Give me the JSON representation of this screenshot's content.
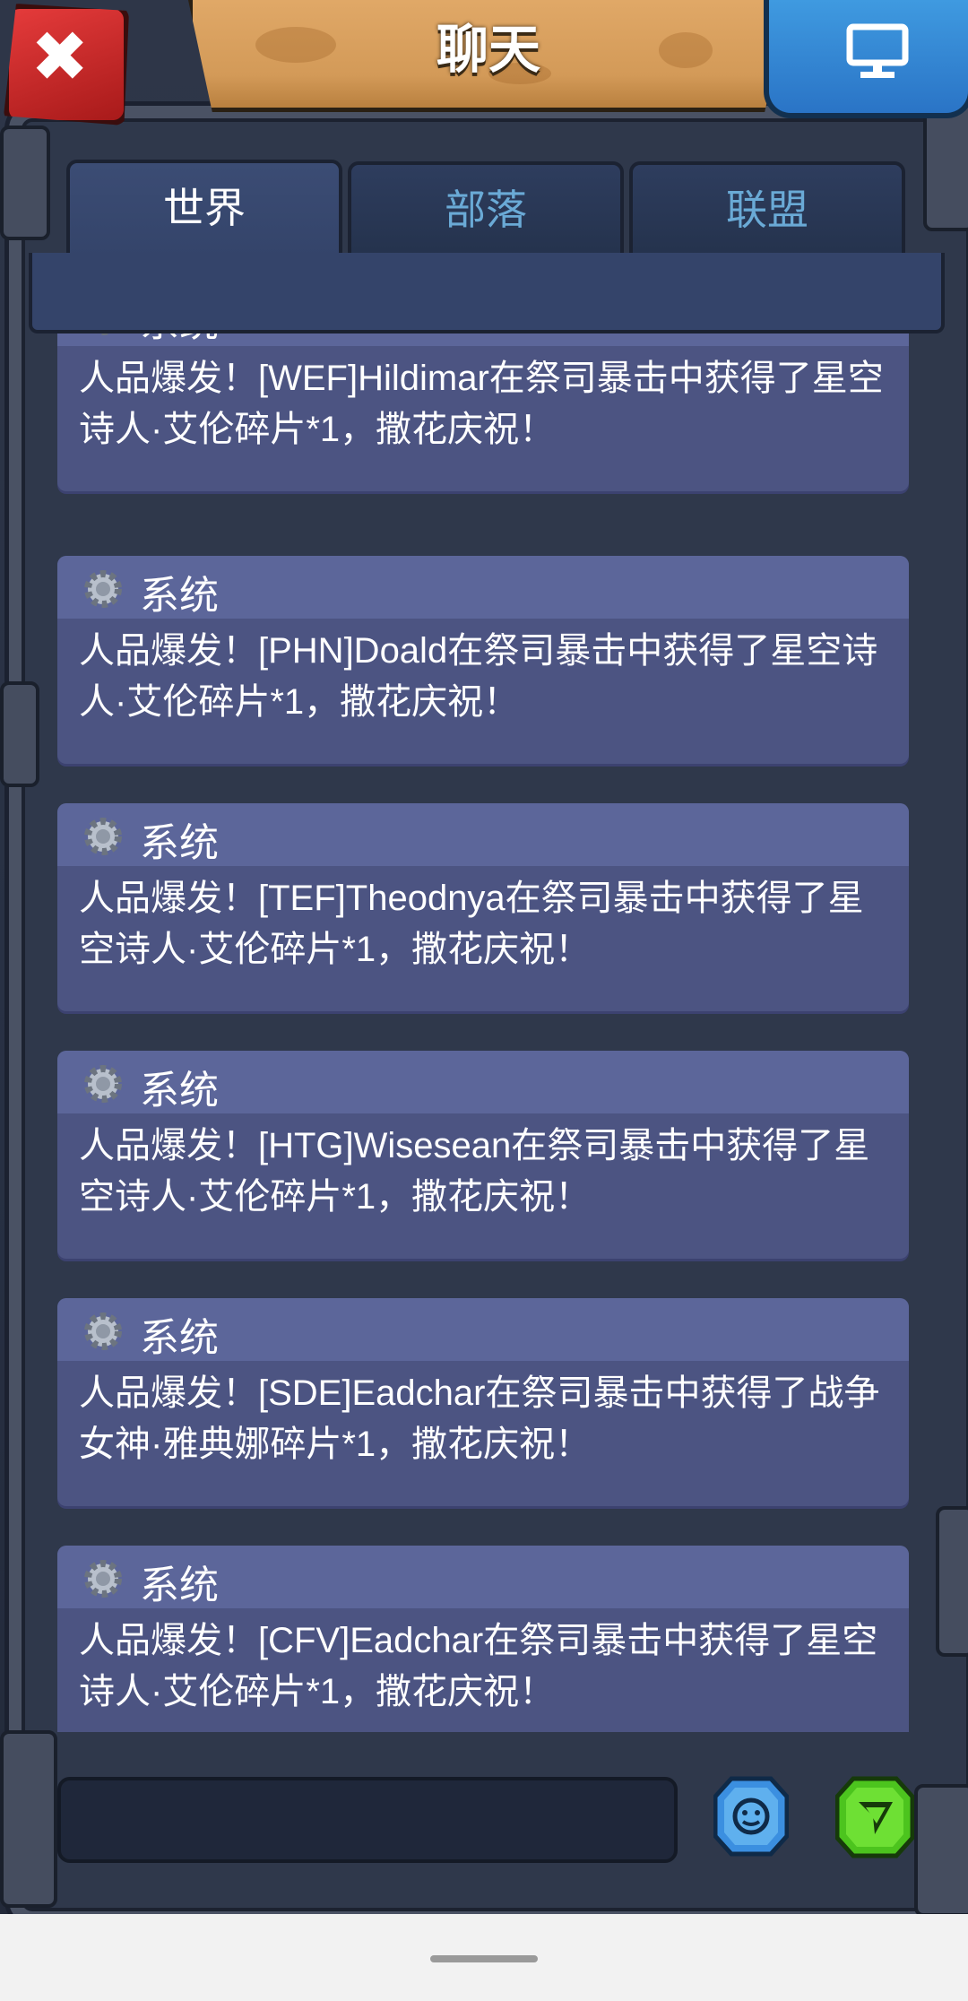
{
  "header": {
    "title": "聊天",
    "close_icon": "close-icon",
    "monitor_icon": "monitor-icon"
  },
  "tabs": [
    {
      "label": "世界",
      "active": true
    },
    {
      "label": "部落",
      "active": false
    },
    {
      "label": "联盟",
      "active": false
    }
  ],
  "messages": [
    {
      "sender": "系统",
      "text": "人品爆发！[WEF]Hildimar在祭司暴击中获得了星空诗人·艾伦碎片*1，撒花庆祝！"
    },
    {
      "sender": "系统",
      "text": "人品爆发！[PHN]Doald在祭司暴击中获得了星空诗人·艾伦碎片*1，撒花庆祝！"
    },
    {
      "sender": "系统",
      "text": "人品爆发！[TEF]Theodnya在祭司暴击中获得了星空诗人·艾伦碎片*1，撒花庆祝！"
    },
    {
      "sender": "系统",
      "text": "人品爆发！[HTG]Wisesean在祭司暴击中获得了星空诗人·艾伦碎片*1，撒花庆祝！"
    },
    {
      "sender": "系统",
      "text": "人品爆发！[SDE]Eadchar在祭司暴击中获得了战争女神·雅典娜碎片*1，撒花庆祝！"
    },
    {
      "sender": "系统",
      "text": "人品爆发！[CFV]Eadchar在祭司暴击中获得了星空诗人·艾伦碎片*1，撒花庆祝！"
    }
  ],
  "input": {
    "value": "",
    "placeholder": ""
  },
  "icons": {
    "emoji": "emoji-icon",
    "send": "send-icon"
  },
  "colors": {
    "tab_inactive_text": "#6aaad6",
    "message_bg": "#4c5482",
    "message_header_bg": "#5c669a",
    "banner": "#d39a58"
  }
}
